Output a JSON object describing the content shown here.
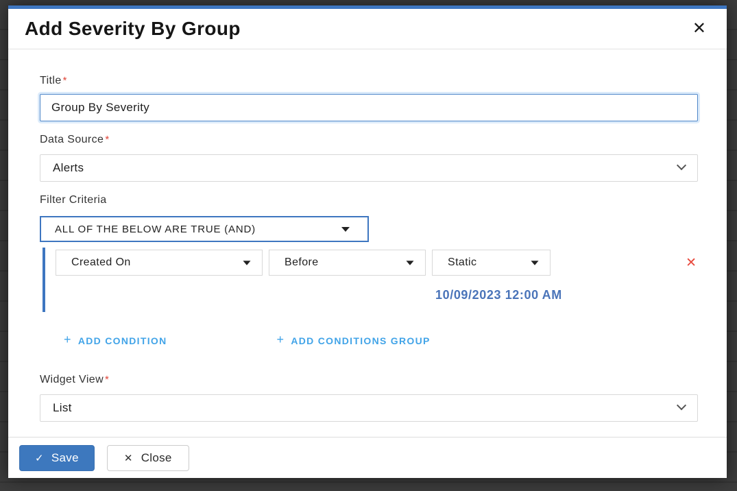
{
  "modal": {
    "title": "Add Severity By Group"
  },
  "icons": {
    "close": "✕",
    "check": "✓",
    "cross": "✕",
    "plus": "+"
  },
  "form": {
    "title_field": {
      "label": "Title",
      "required": "*",
      "value": "Group By Severity"
    },
    "data_source_field": {
      "label": "Data Source",
      "required": "*",
      "value": "Alerts"
    },
    "filter_criteria": {
      "label": "Filter Criteria",
      "match_rule": "ALL OF THE BELOW ARE TRUE (AND)",
      "condition": {
        "field": "Created On",
        "operator": "Before",
        "value_type": "Static",
        "value": "10/09/2023 12:00 AM"
      },
      "add_condition_label": "ADD CONDITION",
      "add_conditions_group_label": "ADD CONDITIONS GROUP"
    },
    "widget_view_field": {
      "label": "Widget View",
      "required": "*",
      "value": "List"
    }
  },
  "footer": {
    "save_label": "Save",
    "close_label": "Close"
  },
  "colors": {
    "accent_blue": "#3e76c0",
    "link_blue": "#42a4e8",
    "date_blue": "#4a74b9",
    "danger_red": "#e8483c",
    "overlay": "#3c3c3c"
  }
}
